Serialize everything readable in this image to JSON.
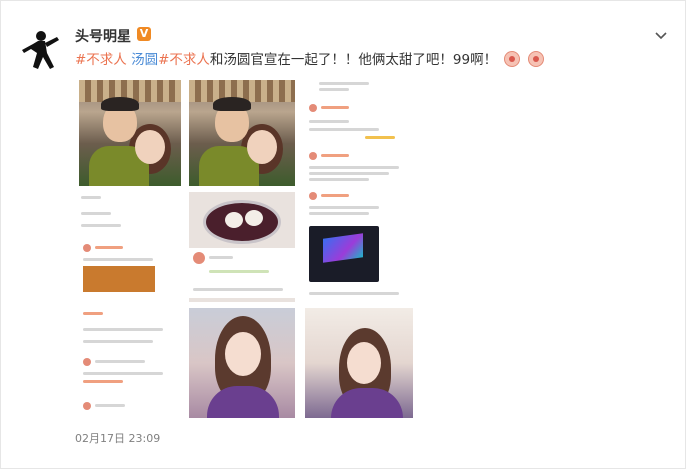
{
  "post": {
    "username": "头号明星",
    "verified_badge": "V",
    "verified_color": "#f08a24",
    "text_parts": [
      {
        "text": "#不求人 ",
        "kind": "topic"
      },
      {
        "text": "汤圆",
        "kind": "topic-blue"
      },
      {
        "text": "#不求人",
        "kind": "topic"
      },
      {
        "text": "和汤圆官宣在一起了！！他俩太甜了吧！99啊！",
        "kind": "plain"
      }
    ],
    "timestamp": "02月17日 23:09",
    "topic_color": "#eb7350",
    "link_color": "#4a8bd6"
  },
  "icons": {
    "avatar": "dancer-silhouette-icon",
    "menu": "chevron-down-icon",
    "emoji": "pig-face-emoji-icon"
  }
}
